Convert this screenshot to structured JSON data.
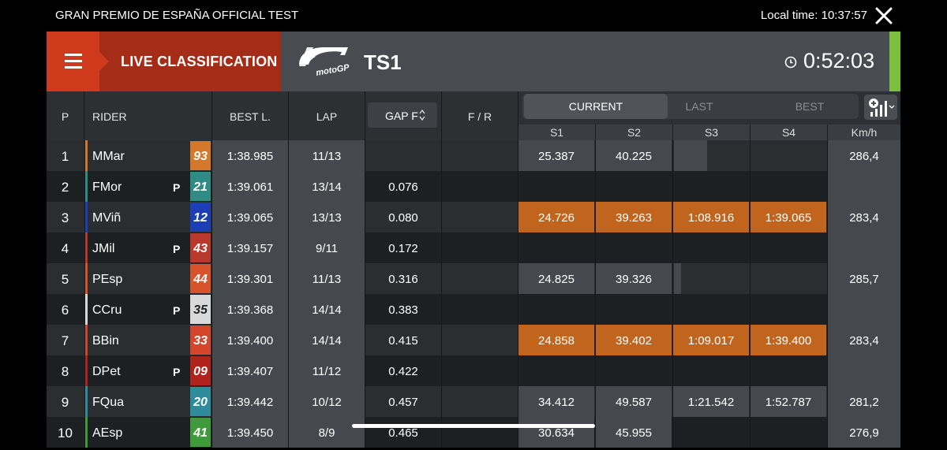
{
  "top_bar": {
    "event_title": "GRAN PREMIO DE ESPAÑA OFFICIAL TEST",
    "local_time": "Local time:  10:37:57",
    "close_icon": "close-x-icon"
  },
  "header": {
    "menu_icon": "hamburger-menu-icon",
    "live_label": "LIVE CLASSIFICATION",
    "logo_text": "motoGP",
    "session": "TS1",
    "clock_icon": "clock-icon",
    "timer": "0:52:03",
    "colors": {
      "menu_bg": "#cf3a1c",
      "live_bg": "#a52c16",
      "status_green": "#7bbf3c",
      "sector_best": "#c1641e"
    }
  },
  "columns": {
    "p": "P",
    "rider": "RIDER",
    "best": "BEST L.",
    "lap": "LAP",
    "gap": "GAP F",
    "fr": "F / R",
    "tabs": [
      "CURRENT",
      "LAST",
      "BEST"
    ],
    "active_tab": "CURRENT",
    "sectors": [
      "S1",
      "S2",
      "S3",
      "S4",
      "Km/h"
    ],
    "settings_icon": "signal-settings-icon"
  },
  "rows": [
    {
      "pos": "1",
      "rider": "MMar",
      "p": "",
      "num": "93",
      "num_color": "#d6782a",
      "stripe": "#d6782a",
      "best": "1:38.985",
      "lap": "11/13",
      "gap": "",
      "s1": "25.387",
      "s2": "40.225",
      "s3": "",
      "s4": "",
      "kmh": "286,4"
    },
    {
      "pos": "2",
      "rider": "FMor",
      "p": "P",
      "num": "21",
      "num_color": "#2e8c84",
      "stripe": "#2e8c84",
      "best": "1:39.061",
      "lap": "13/14",
      "gap": "0.076",
      "s1": "",
      "s2": "",
      "s3": "",
      "s4": "",
      "kmh": ""
    },
    {
      "pos": "3",
      "rider": "MViñ",
      "p": "",
      "num": "12",
      "num_color": "#1c3fb5",
      "stripe": "#1c3fb5",
      "best": "1:39.065",
      "lap": "13/13",
      "gap": "0.080",
      "s1": "24.726",
      "s2": "39.263",
      "s3": "1:08.916",
      "s4": "1:39.065",
      "kmh": "283,4"
    },
    {
      "pos": "4",
      "rider": "JMil",
      "p": "P",
      "num": "43",
      "num_color": "#b8392c",
      "stripe": "#b8392c",
      "best": "1:39.157",
      "lap": "9/11",
      "gap": "0.172",
      "s1": "",
      "s2": "",
      "s3": "",
      "s4": "",
      "kmh": ""
    },
    {
      "pos": "5",
      "rider": "PEsp",
      "p": "",
      "num": "44",
      "num_color": "#d8532a",
      "stripe": "#d8532a",
      "best": "1:39.301",
      "lap": "11/13",
      "gap": "0.316",
      "s1": "24.825",
      "s2": "39.326",
      "s3": "",
      "s4": "",
      "kmh": "285,7"
    },
    {
      "pos": "6",
      "rider": "CCru",
      "p": "P",
      "num": "35",
      "num_color": "#d9d9d9",
      "stripe": "#d9d9d9",
      "best": "1:39.368",
      "lap": "14/14",
      "gap": "0.383",
      "s1": "",
      "s2": "",
      "s3": "",
      "s4": "",
      "kmh": ""
    },
    {
      "pos": "7",
      "rider": "BBin",
      "p": "",
      "num": "33",
      "num_color": "#d5452b",
      "stripe": "#d5452b",
      "best": "1:39.400",
      "lap": "14/14",
      "gap": "0.415",
      "s1": "24.858",
      "s2": "39.402",
      "s3": "1:09.017",
      "s4": "1:39.400",
      "kmh": "283,4"
    },
    {
      "pos": "8",
      "rider": "DPet",
      "p": "P",
      "num": "09",
      "num_color": "#b0231c",
      "stripe": "#b0231c",
      "best": "1:39.407",
      "lap": "11/12",
      "gap": "0.422",
      "s1": "",
      "s2": "",
      "s3": "",
      "s4": "",
      "kmh": ""
    },
    {
      "pos": "9",
      "rider": "FQua",
      "p": "",
      "num": "20",
      "num_color": "#2e8c9a",
      "stripe": "#2e8c9a",
      "best": "1:39.442",
      "lap": "10/12",
      "gap": "0.457",
      "s1": "34.412",
      "s2": "49.587",
      "s3": "1:21.542",
      "s4": "1:52.787",
      "kmh": "281,2"
    },
    {
      "pos": "10",
      "rider": "AEsp",
      "p": "",
      "num": "41",
      "num_color": "#3f9a3a",
      "stripe": "#3f9a3a",
      "best": "1:39.450",
      "lap": "8/9",
      "gap": "0.465",
      "s1": "30.634",
      "s2": "45.955",
      "s3": "",
      "s4": "",
      "kmh": "276,9"
    }
  ]
}
